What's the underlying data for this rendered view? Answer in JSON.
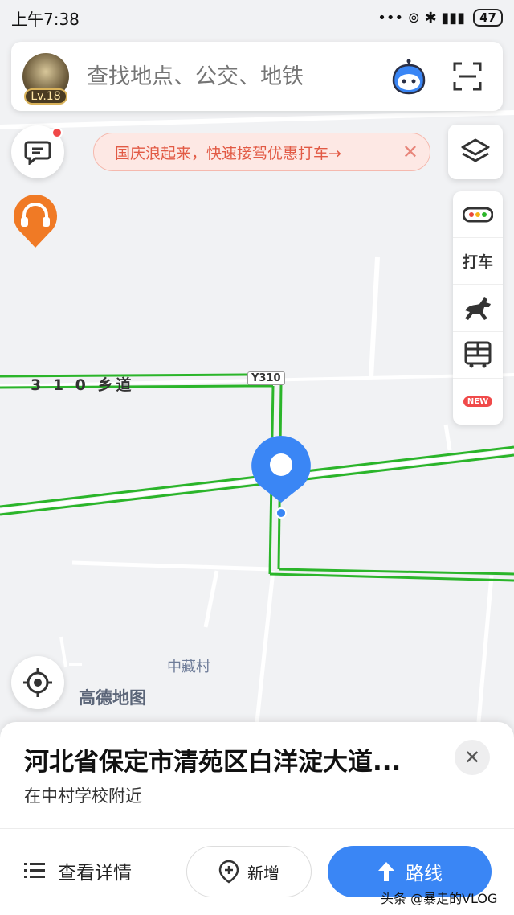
{
  "status_bar": {
    "time": "上午7:38",
    "signal_icons": "••• ⊚ ✱ ▮▮▮",
    "battery": "47"
  },
  "search": {
    "level_badge": "Lv.18",
    "placeholder": "查找地点、公交、地铁"
  },
  "banner": {
    "text": "国庆浪起来，快速接驾优惠打车→",
    "close": "✕"
  },
  "toolbar": {
    "taxi_label": "打车",
    "new_badge": "NEW"
  },
  "map": {
    "road_label": "3 1 0 乡道",
    "road_code": "Y310",
    "village_label": "中藏村",
    "logo_text": "高德地图"
  },
  "place_sheet": {
    "address": "河北省保定市清苑区白洋淀大道...",
    "nearby": "在中村学校附近",
    "close": "✕",
    "details_label": "查看详情",
    "add_label": "新增",
    "route_label": "路线"
  },
  "watermark": "头条 @暴走的VLOG",
  "colors": {
    "accent": "#3a86f5",
    "route_green": "#2bb52a",
    "banner_text": "#e25a45",
    "badge_red": "#f04a4a"
  },
  "icons": [
    "assistant-icon",
    "scan-icon",
    "message-icon",
    "headset-icon",
    "layers-icon",
    "traffic-icon",
    "horse-icon",
    "bus-icon",
    "locate-icon",
    "list-icon",
    "add-pin-icon",
    "route-arrow-icon",
    "close-icon",
    "location-pin-icon"
  ]
}
